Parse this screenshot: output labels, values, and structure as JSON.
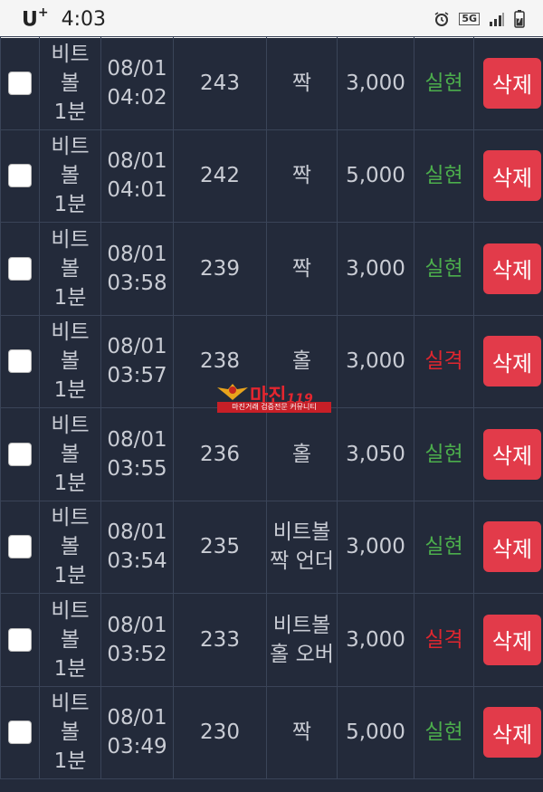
{
  "status_bar": {
    "carrier": "U",
    "carrier_suffix": "+",
    "time": "4:03",
    "network": "5G",
    "icons": [
      "alarm-icon",
      "network-5g-icon",
      "signal-icon",
      "battery-icon"
    ]
  },
  "watermark": {
    "logo_text": "마진",
    "logo_suffix": "119",
    "tagline": "마진거래 검증전문 커뮤니티"
  },
  "colors": {
    "background": "#232a3a",
    "border": "#3a4458",
    "text": "#c9ccd4",
    "win": "#4cae4c",
    "lose": "#e0262f",
    "delete_button": "#e23b4a"
  },
  "bets": [
    {
      "game": "비트\n볼\n1분",
      "time": "08/01\n04:02",
      "round": "243",
      "pick": "짝",
      "amount": "3,000",
      "result": "실현",
      "status": "win",
      "action": "삭제"
    },
    {
      "game": "비트\n볼\n1분",
      "time": "08/01\n04:01",
      "round": "242",
      "pick": "짝",
      "amount": "5,000",
      "result": "실현",
      "status": "win",
      "action": "삭제"
    },
    {
      "game": "비트\n볼\n1분",
      "time": "08/01\n03:58",
      "round": "239",
      "pick": "짝",
      "amount": "3,000",
      "result": "실현",
      "status": "win",
      "action": "삭제"
    },
    {
      "game": "비트\n볼\n1분",
      "time": "08/01\n03:57",
      "round": "238",
      "pick": "홀",
      "amount": "3,000",
      "result": "실격",
      "status": "lose",
      "action": "삭제"
    },
    {
      "game": "비트\n볼\n1분",
      "time": "08/01\n03:55",
      "round": "236",
      "pick": "홀",
      "amount": "3,050",
      "result": "실현",
      "status": "win",
      "action": "삭제"
    },
    {
      "game": "비트\n볼\n1분",
      "time": "08/01\n03:54",
      "round": "235",
      "pick": "비트볼\n짝 언더",
      "amount": "3,000",
      "result": "실현",
      "status": "win",
      "action": "삭제"
    },
    {
      "game": "비트\n볼\n1분",
      "time": "08/01\n03:52",
      "round": "233",
      "pick": "비트볼\n홀 오버",
      "amount": "3,000",
      "result": "실격",
      "status": "lose",
      "action": "삭제"
    },
    {
      "game": "비트\n볼\n1분",
      "time": "08/01\n03:49",
      "round": "230",
      "pick": "짝",
      "amount": "5,000",
      "result": "실현",
      "status": "win",
      "action": "삭제"
    }
  ]
}
